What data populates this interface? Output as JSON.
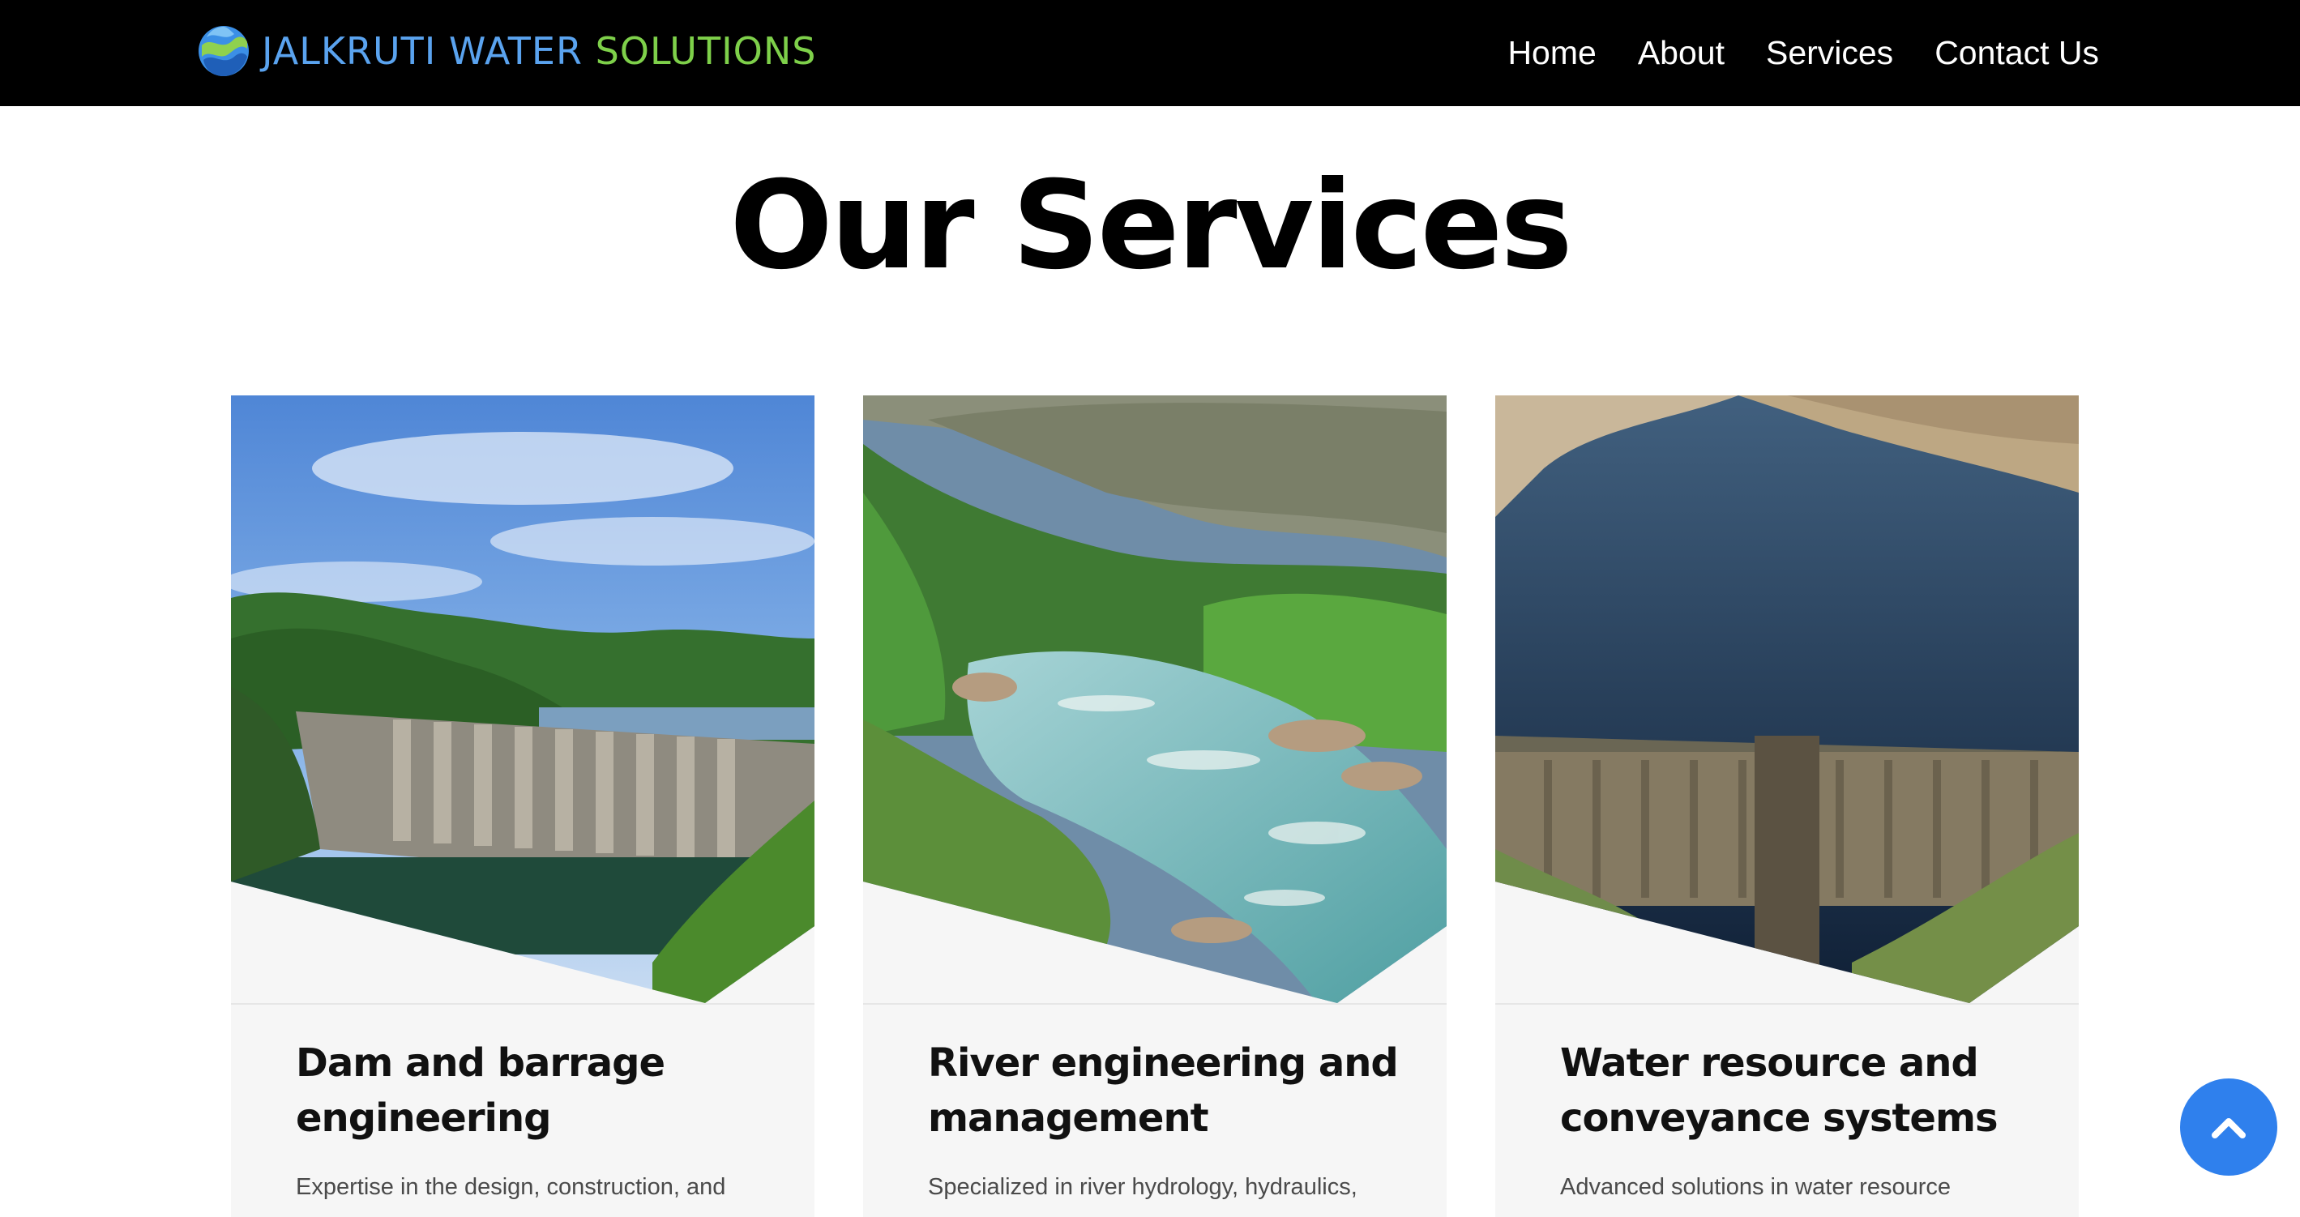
{
  "brand": {
    "name_part1": "JALKRUTI WATER ",
    "name_part2": "SOLUTIONS",
    "logo_icon": "water-wave-logo-icon",
    "color_blue": "#5aa3ef",
    "color_green": "#7ed04a"
  },
  "nav": {
    "items": [
      {
        "label": "Home"
      },
      {
        "label": "About"
      },
      {
        "label": "Services"
      },
      {
        "label": "Contact Us"
      }
    ]
  },
  "services": {
    "title": "Our Services",
    "cards": [
      {
        "image": "dam-with-spillway-gates-photo",
        "title": "Dam and barrage engineering",
        "description": "Expertise in the design, construction, and"
      },
      {
        "image": "mountain-river-forest-photo",
        "title": "River engineering and management",
        "description": "Specialized in river hydrology, hydraulics,"
      },
      {
        "image": "reservoir-arch-dam-aerial-photo",
        "title": "Water resource and conveyance systems",
        "description": "Advanced solutions in water resource"
      }
    ]
  },
  "scroll_top": {
    "icon": "chevron-up-icon",
    "color": "#2f80ed"
  }
}
